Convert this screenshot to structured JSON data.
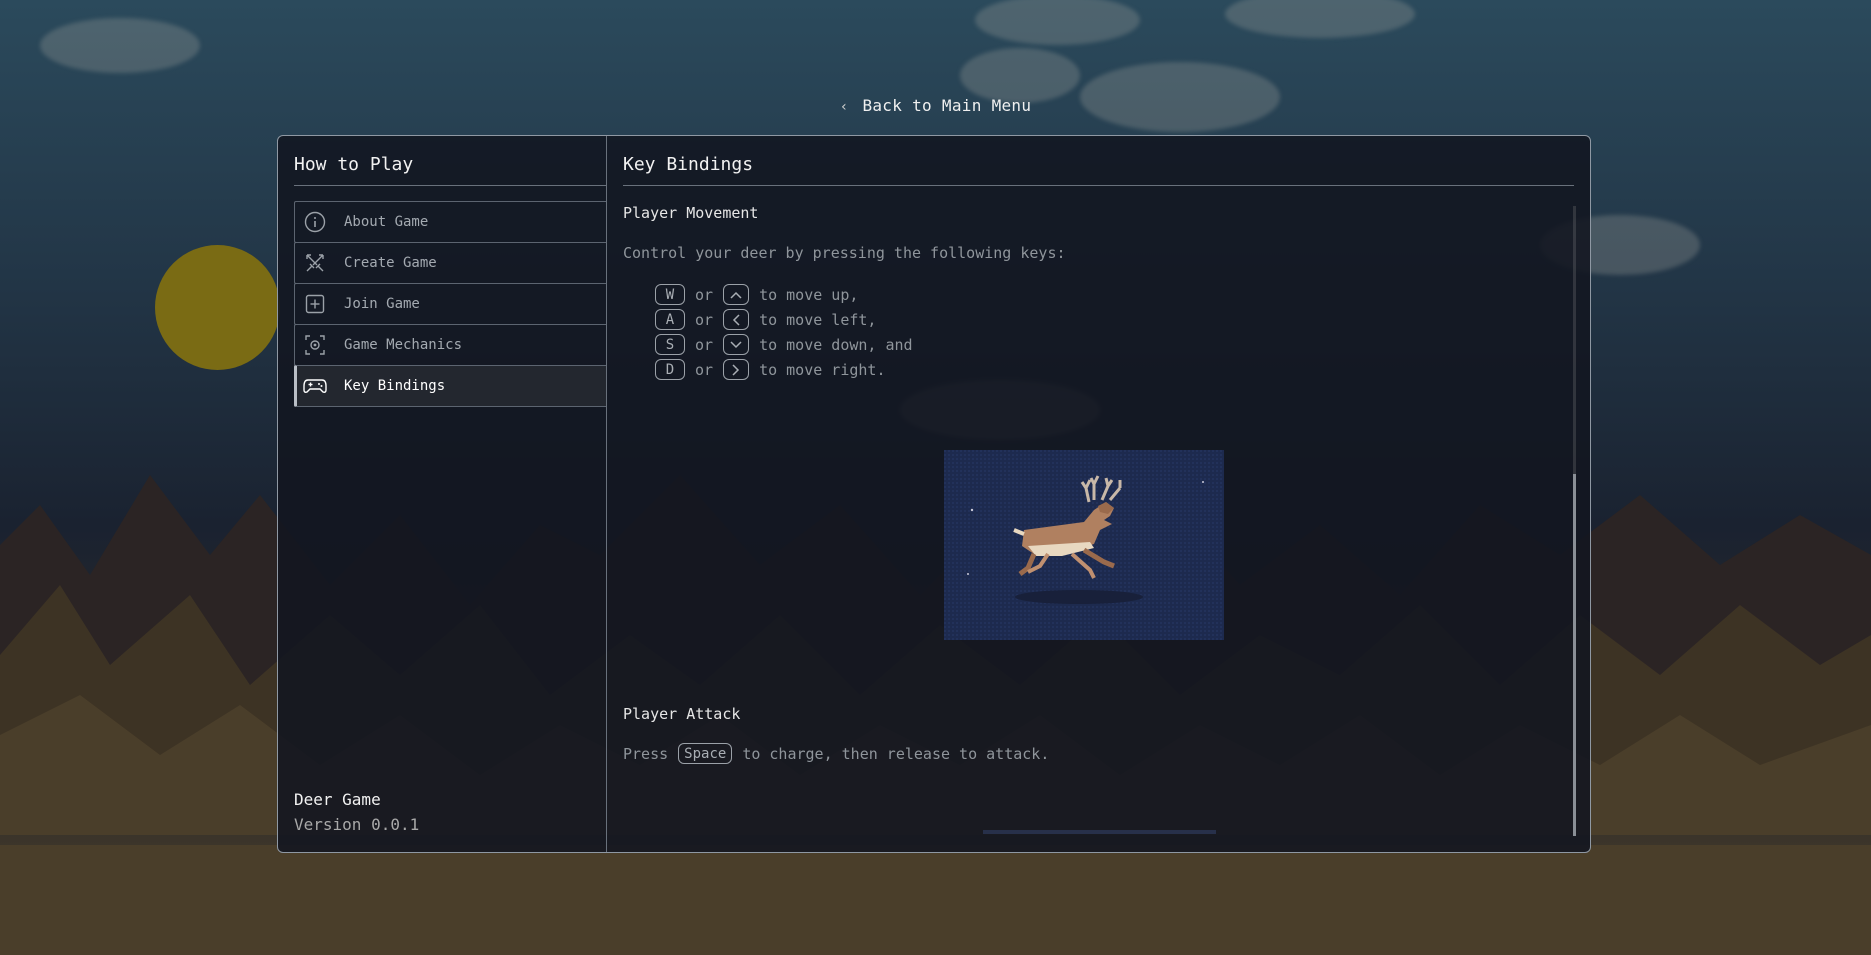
{
  "back_link": {
    "label": "Back to Main Menu",
    "icon": "chevron-left-icon"
  },
  "sidebar": {
    "title": "How to Play",
    "items": [
      {
        "label": "About Game",
        "icon": "info-icon"
      },
      {
        "label": "Create Game",
        "icon": "crossed-swords-icon"
      },
      {
        "label": "Join Game",
        "icon": "plus-square-icon"
      },
      {
        "label": "Game Mechanics",
        "icon": "gear-frame-icon"
      },
      {
        "label": "Key Bindings",
        "icon": "gamepad-icon",
        "active": true
      }
    ],
    "footer": {
      "game_name": "Deer Game",
      "version": "Version 0.0.1"
    }
  },
  "content": {
    "title": "Key Bindings",
    "movement": {
      "heading": "Player Movement",
      "intro": "Control your deer by pressing the following keys:",
      "rows": [
        {
          "key": "W",
          "or": "or",
          "arrow": "up-arrow-icon",
          "desc": "to move up,"
        },
        {
          "key": "A",
          "or": "or",
          "arrow": "left-arrow-icon",
          "desc": "to move left,"
        },
        {
          "key": "S",
          "or": "or",
          "arrow": "down-arrow-icon",
          "desc": "to move down, and"
        },
        {
          "key": "D",
          "or": "or",
          "arrow": "right-arrow-icon",
          "desc": "to move right."
        }
      ]
    },
    "attack": {
      "heading": "Player Attack",
      "before": "Press",
      "key": "Space",
      "after": "to charge, then release to attack."
    }
  },
  "colors": {
    "panel_bg": "#12161f",
    "border": "#8f98a3",
    "accent_text": "#f2f2f2",
    "muted_text": "#8f959b",
    "deer_bg": "#1d2a4e"
  }
}
